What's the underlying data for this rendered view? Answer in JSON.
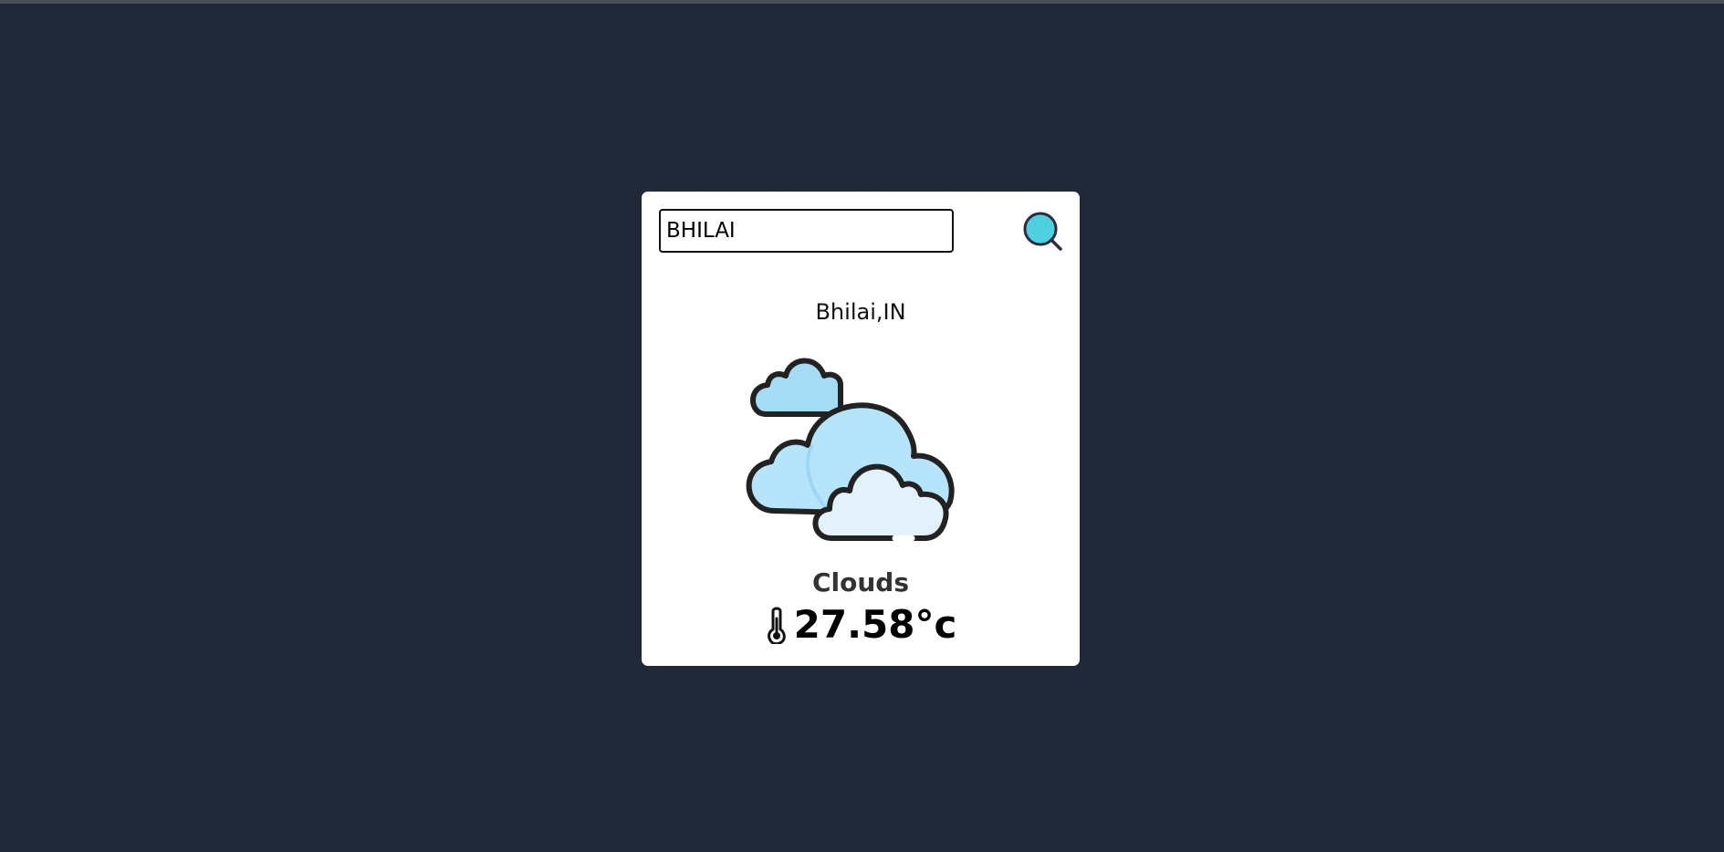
{
  "colors": {
    "page_background": "#212938",
    "card_background": "#ffffff",
    "search_icon_fill": "#4fcfe0",
    "cloud_back": "#a5dcf5",
    "cloud_main": "#b6e4fb",
    "cloud_front": "#e2f1fa",
    "outline": "#222222"
  },
  "search": {
    "value": "BHILAI",
    "icon": "search-icon"
  },
  "weather": {
    "location": "Bhilai,IN",
    "icon": "clouds-icon",
    "condition": "Clouds",
    "temperature_icon": "thermometer-icon",
    "temperature": "27.58°c"
  }
}
